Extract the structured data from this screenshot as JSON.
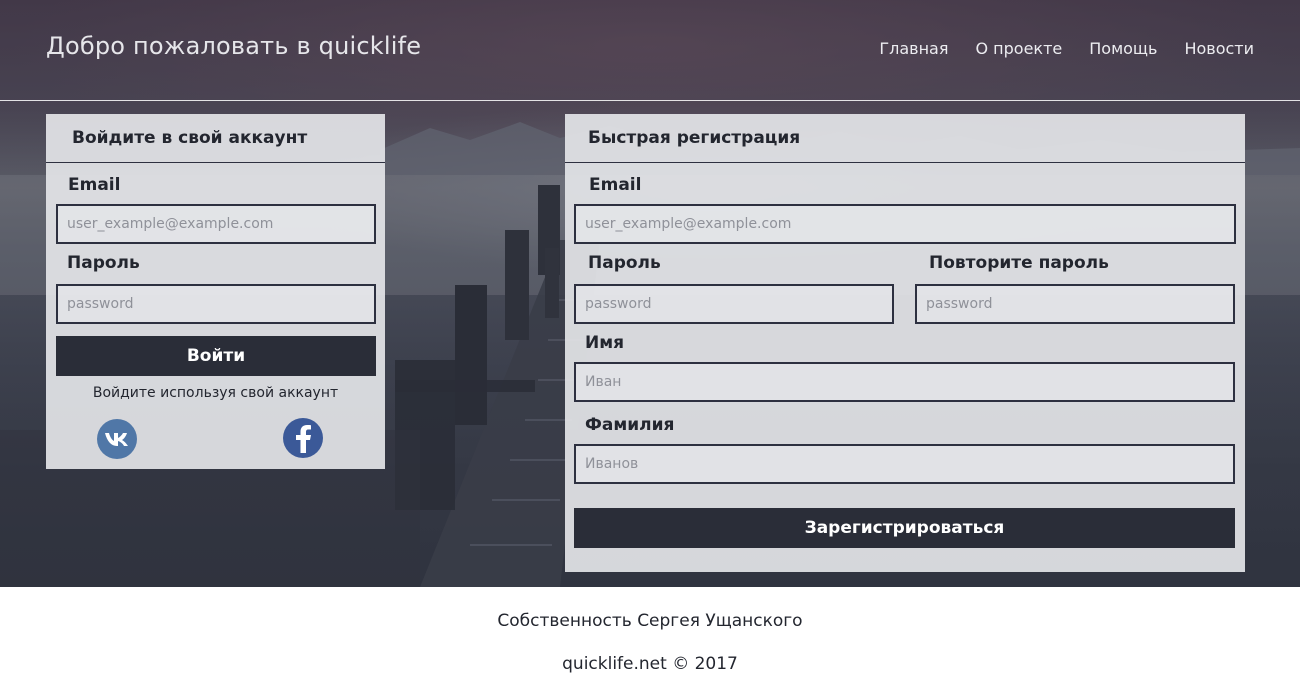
{
  "header": {
    "brand": "Добро пожаловать в quicklife",
    "nav": [
      "Главная",
      "О проекте",
      "Помощь",
      "Новости"
    ]
  },
  "login": {
    "title": "Войдите в свой аккаунт",
    "email_label": "Email",
    "email_placeholder": "user_example@example.com",
    "password_label": "Пароль",
    "password_placeholder": "password",
    "submit_label": "Войти",
    "social_hint": "Войдите используя свой аккаунт",
    "social_icons": [
      "vk-icon",
      "facebook-icon"
    ]
  },
  "register": {
    "title": "Быстрая регистрация",
    "email_label": "Email",
    "email_placeholder": "user_example@example.com",
    "password_label": "Пароль",
    "password_placeholder": "password",
    "repeat_label": "Повторите пароль",
    "repeat_placeholder": "password",
    "first_name_label": "Имя",
    "first_name_placeholder": "Иван",
    "last_name_label": "Фамилия",
    "last_name_placeholder": "Иванов",
    "submit_label": "Зарегистрироваться"
  },
  "footer": {
    "owner": "Собственность Сергея Ущанского",
    "copyright": "quicklife.net © 2017"
  },
  "colors": {
    "panel": "#e4e5e8",
    "button": "#2a2d38",
    "vk": "#5077a7",
    "facebook": "#3b5998"
  }
}
